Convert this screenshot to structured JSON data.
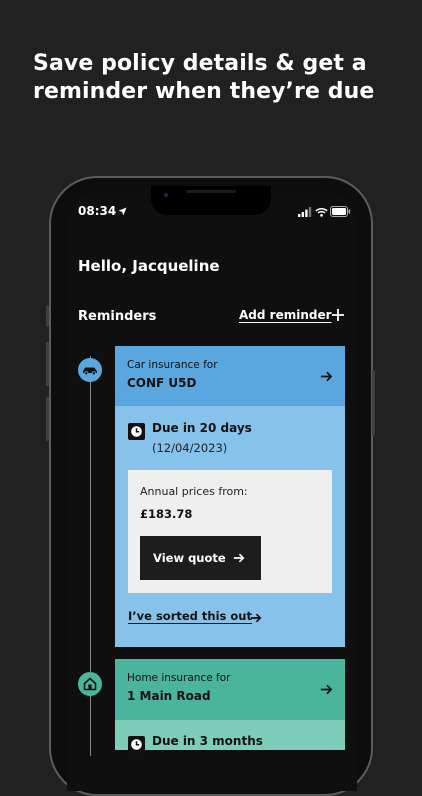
{
  "headline": {
    "line1": "Save policy details & get a",
    "line2": "reminder when they’re due"
  },
  "status_bar": {
    "time": "08:34"
  },
  "greeting": "Hello, Jacqueline",
  "reminders": {
    "title": "Reminders",
    "add_label": "Add reminder"
  },
  "cards": [
    {
      "type": "car",
      "subtitle": "Car insurance for",
      "registration": "CONF U5D",
      "due_text": "Due in 20 days",
      "due_date": "(12/04/2023)",
      "price_label": "Annual prices from:",
      "price_value": "£183.78",
      "cta_label": "View quote",
      "sorted_label": "I’ve sorted this out",
      "icon": "car-icon",
      "head_color": "#5aa7df",
      "body_color": "#86c2ea"
    },
    {
      "type": "home",
      "subtitle": "Home insurance for",
      "registration": "1 Main Road",
      "due_text": "Due in 3 months",
      "icon": "house-icon",
      "head_color": "#4bb49c",
      "body_color": "#7ecdb9"
    }
  ],
  "colors": {
    "background": "#212121",
    "screen": "#0f0f0f",
    "car_accent": "#5aa7df",
    "home_accent": "#4bb49c"
  }
}
